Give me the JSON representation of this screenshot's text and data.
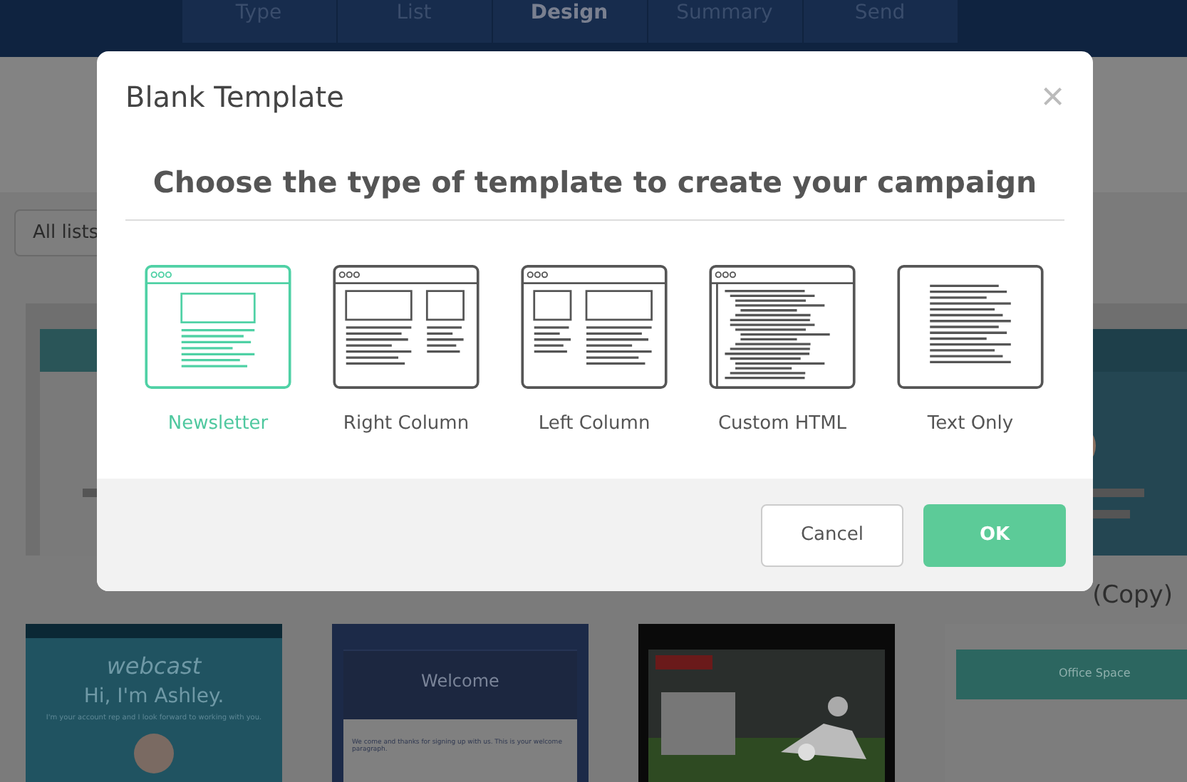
{
  "steps": [
    {
      "label": "Type",
      "selected": false
    },
    {
      "label": "List",
      "selected": false
    },
    {
      "label": "Design",
      "selected": true
    },
    {
      "label": "Summary",
      "selected": false
    },
    {
      "label": "Send",
      "selected": false
    }
  ],
  "filter": {
    "value": "All lists"
  },
  "copy_caption": "(Copy)",
  "templates": [
    {
      "kind": "webcast",
      "brand": "webcast",
      "heading": "Hi, I'm Ashley.",
      "text": "I'm your account rep and I look forward to working with you."
    },
    {
      "kind": "welcome",
      "heading": "Welcome",
      "text": "We come and thanks for signing up with us. This is your welcome paragraph."
    },
    {
      "kind": "tickets"
    },
    {
      "kind": "office",
      "heading": "Office Space"
    }
  ],
  "modal": {
    "title": "Blank Template",
    "close": "×",
    "heading": "Choose the type of template to create your campaign",
    "options": [
      {
        "label": "Newsletter",
        "kind": "newsletter",
        "selected": true
      },
      {
        "label": "Right Column",
        "kind": "right",
        "selected": false
      },
      {
        "label": "Left Column",
        "kind": "left",
        "selected": false
      },
      {
        "label": "Custom HTML",
        "kind": "html",
        "selected": false
      },
      {
        "label": "Text Only",
        "kind": "text",
        "selected": false
      }
    ],
    "buttons": {
      "cancel": "Cancel",
      "ok": "OK"
    }
  }
}
